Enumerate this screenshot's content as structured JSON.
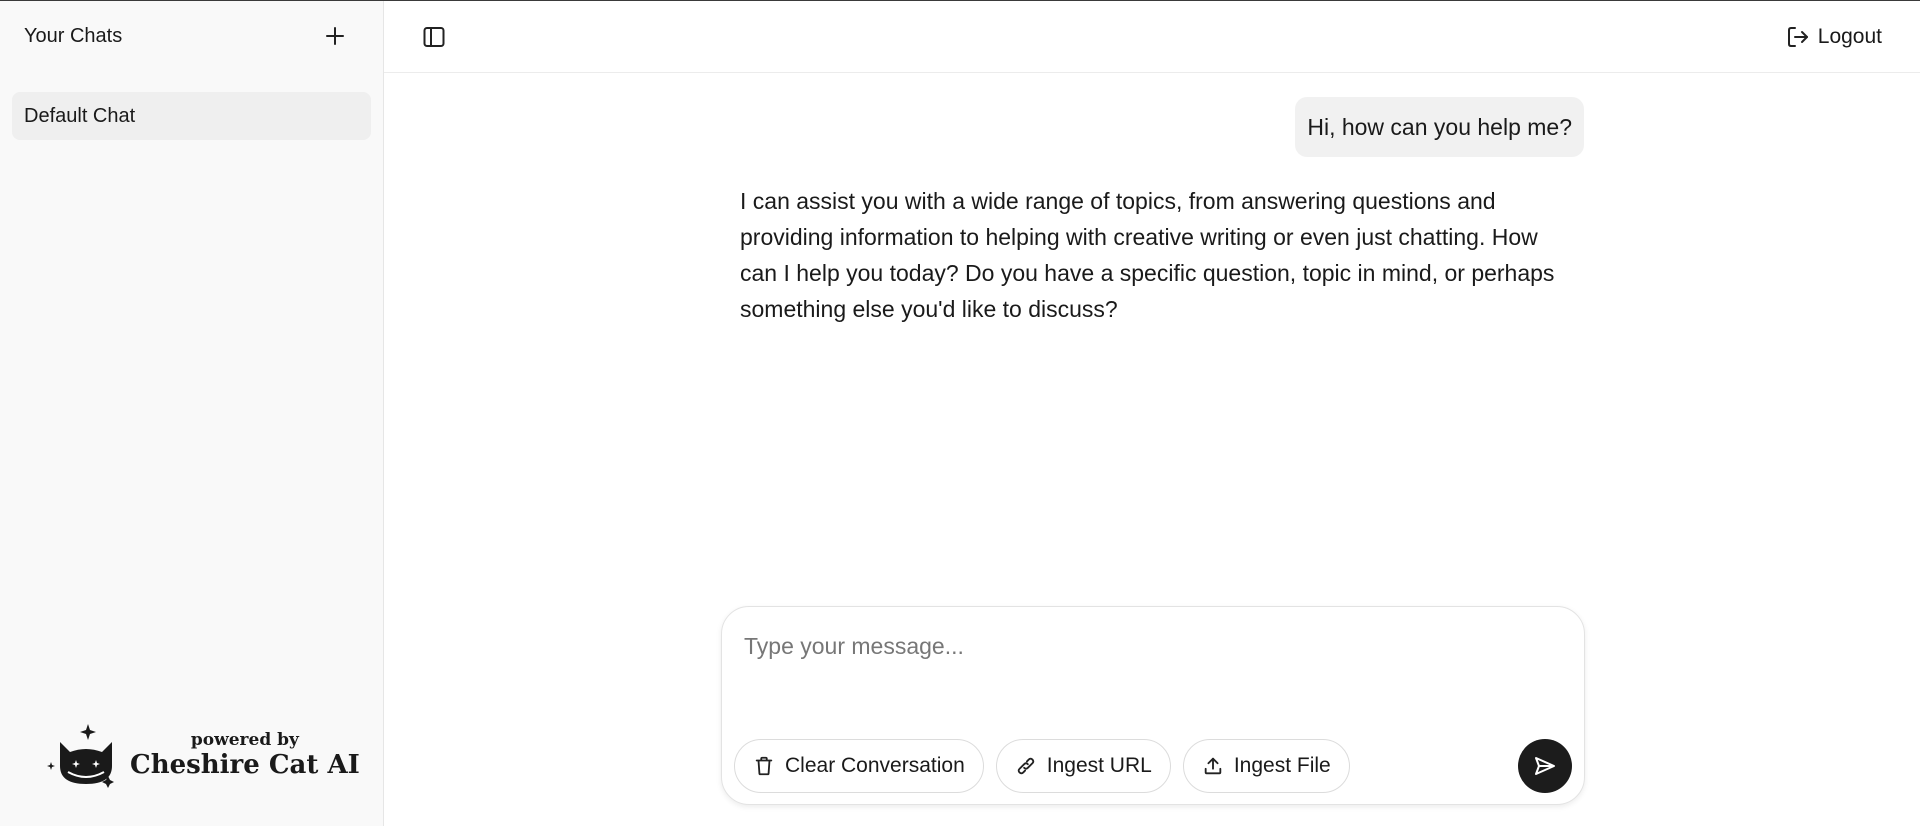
{
  "sidebar": {
    "title": "Your Chats",
    "new_chat_icon": "plus-icon",
    "chats": [
      {
        "label": "Default Chat"
      }
    ],
    "powered_by": "powered by",
    "brand_name": "Cheshire Cat AI"
  },
  "topbar": {
    "toggle_icon": "sidebar-toggle-icon",
    "logout_label": "Logout",
    "logout_icon": "logout-icon"
  },
  "conversation": {
    "messages": [
      {
        "role": "user",
        "text": "Hi, how can you help me?"
      },
      {
        "role": "assistant",
        "text": "I can assist you with a wide range of topics, from answering questions and providing information to helping with creative writing or even just chatting. How can I help you today? Do you have a specific question, topic in mind, or perhaps something else you'd like to discuss?"
      }
    ]
  },
  "composer": {
    "placeholder": "Type your message...",
    "value": "",
    "clear_label": "Clear Conversation",
    "ingest_url_label": "Ingest URL",
    "ingest_file_label": "Ingest File",
    "send_icon": "send-icon"
  },
  "colors": {
    "sidebar_bg": "#f9f9f9",
    "active_chat_bg": "#efefef",
    "user_bubble_bg": "#f1f1f1",
    "send_button_bg": "#1c1c1c"
  }
}
